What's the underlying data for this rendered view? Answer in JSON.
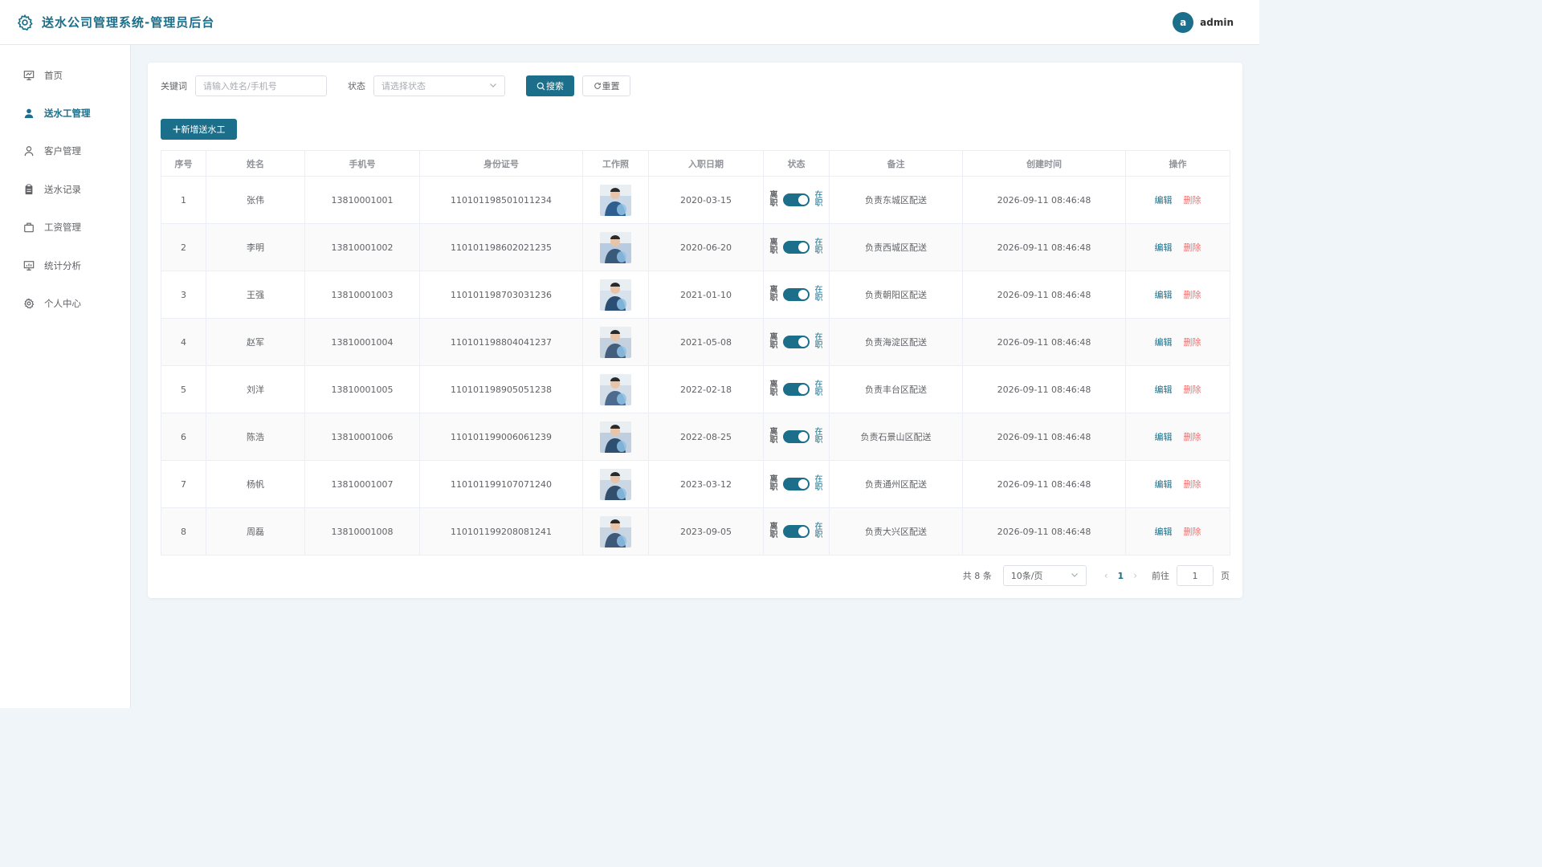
{
  "app": {
    "title": "送水公司管理系统-管理员后台"
  },
  "user": {
    "avatar_letter": "a",
    "name": "admin"
  },
  "sidebar": {
    "items": [
      {
        "label": "首页",
        "icon": "dashboard-icon",
        "active": false
      },
      {
        "label": "送水工管理",
        "icon": "user-filled-icon",
        "active": true
      },
      {
        "label": "客户管理",
        "icon": "user-icon",
        "active": false
      },
      {
        "label": "送水记录",
        "icon": "clipboard-icon",
        "active": false
      },
      {
        "label": "工资管理",
        "icon": "briefcase-icon",
        "active": false
      },
      {
        "label": "统计分析",
        "icon": "chart-icon",
        "active": false
      },
      {
        "label": "个人中心",
        "icon": "gear-icon",
        "active": false
      }
    ]
  },
  "filters": {
    "keyword_label": "关键词",
    "keyword_placeholder": "请输入姓名/手机号",
    "status_label": "状态",
    "status_placeholder": "请选择状态",
    "search_label": "搜索",
    "reset_label": "重置"
  },
  "actions": {
    "add_label": "新增送水工"
  },
  "table": {
    "columns": [
      "序号",
      "姓名",
      "手机号",
      "身份证号",
      "工作照",
      "入职日期",
      "状态",
      "备注",
      "创建时间",
      "操作"
    ],
    "status_off_label": "离职",
    "status_on_label": "在职",
    "edit_label": "编辑",
    "delete_label": "删除",
    "rows": [
      {
        "index": "1",
        "name": "张伟",
        "phone": "13810001001",
        "id_card": "110101198501011234",
        "hire_date": "2020-03-15",
        "active": true,
        "remark": "负责东城区配送",
        "created": "2026-09-11 08:46:48"
      },
      {
        "index": "2",
        "name": "李明",
        "phone": "13810001002",
        "id_card": "110101198602021235",
        "hire_date": "2020-06-20",
        "active": true,
        "remark": "负责西城区配送",
        "created": "2026-09-11 08:46:48"
      },
      {
        "index": "3",
        "name": "王强",
        "phone": "13810001003",
        "id_card": "110101198703031236",
        "hire_date": "2021-01-10",
        "active": true,
        "remark": "负责朝阳区配送",
        "created": "2026-09-11 08:46:48"
      },
      {
        "index": "4",
        "name": "赵军",
        "phone": "13810001004",
        "id_card": "110101198804041237",
        "hire_date": "2021-05-08",
        "active": true,
        "remark": "负责海淀区配送",
        "created": "2026-09-11 08:46:48"
      },
      {
        "index": "5",
        "name": "刘洋",
        "phone": "13810001005",
        "id_card": "110101198905051238",
        "hire_date": "2022-02-18",
        "active": true,
        "remark": "负责丰台区配送",
        "created": "2026-09-11 08:46:48"
      },
      {
        "index": "6",
        "name": "陈浩",
        "phone": "13810001006",
        "id_card": "110101199006061239",
        "hire_date": "2022-08-25",
        "active": true,
        "remark": "负责石景山区配送",
        "created": "2026-09-11 08:46:48"
      },
      {
        "index": "7",
        "name": "杨帆",
        "phone": "13810001007",
        "id_card": "110101199107071240",
        "hire_date": "2023-03-12",
        "active": true,
        "remark": "负责通州区配送",
        "created": "2026-09-11 08:46:48"
      },
      {
        "index": "8",
        "name": "周磊",
        "phone": "13810001008",
        "id_card": "110101199208081241",
        "hire_date": "2023-09-05",
        "active": true,
        "remark": "负责大兴区配送",
        "created": "2026-09-11 08:46:48"
      }
    ]
  },
  "pager": {
    "total_text": "共 8 条",
    "page_size": "10条/页",
    "current_page": "1",
    "goto_label": "前往",
    "goto_value": "1",
    "page_suffix": "页"
  },
  "colors": {
    "accent": "#1b6f8a",
    "danger": "#f56c6c",
    "bg": "#f0f5fa"
  }
}
